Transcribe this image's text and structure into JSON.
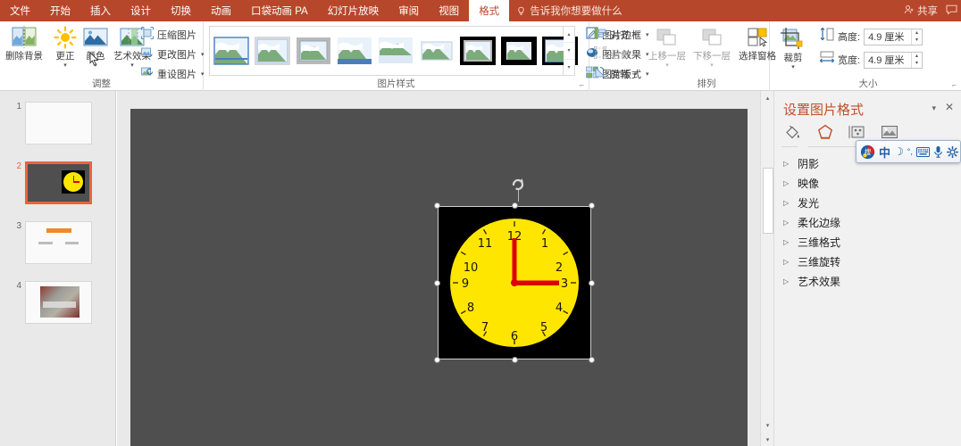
{
  "menubar": {
    "tabs": [
      {
        "label": "文件",
        "active": false
      },
      {
        "label": "开始",
        "active": false
      },
      {
        "label": "插入",
        "active": false
      },
      {
        "label": "设计",
        "active": false
      },
      {
        "label": "切换",
        "active": false
      },
      {
        "label": "动画",
        "active": false
      },
      {
        "label": "口袋动画 PA",
        "active": false
      },
      {
        "label": "幻灯片放映",
        "active": false
      },
      {
        "label": "审阅",
        "active": false
      },
      {
        "label": "视图",
        "active": false
      },
      {
        "label": "格式",
        "active": true
      }
    ],
    "tell_me": "告诉我你想要做什么",
    "share_label": "共享",
    "bulb_icon": "lightbulb-icon",
    "share_icon": "person-add-icon",
    "comment_icon": "comment-icon",
    "accent_color": "#b7472a"
  },
  "ribbon": {
    "groups": [
      {
        "name": "adjust",
        "label": "调整",
        "big_buttons": [
          {
            "label": "删除背景",
            "icon": "remove-background-icon",
            "has_caret": false
          },
          {
            "label": "更正",
            "icon": "corrections-sun-icon",
            "has_caret": true
          },
          {
            "label": "颜色",
            "icon": "color-picture-icon",
            "has_caret": true
          },
          {
            "label": "艺术效果",
            "icon": "artistic-effects-icon",
            "has_caret": true
          }
        ],
        "small_buttons": [
          {
            "label": "压缩图片",
            "icon": "compress-picture-icon",
            "has_caret": false
          },
          {
            "label": "更改图片",
            "icon": "change-picture-icon",
            "has_caret": true
          },
          {
            "label": "重设图片",
            "icon": "reset-picture-icon",
            "has_caret": true
          }
        ]
      },
      {
        "name": "picture-styles",
        "label": "图片样式",
        "gallery_count": 9,
        "small_buttons": [
          {
            "label": "图片边框",
            "icon": "picture-border-icon",
            "has_caret": true
          },
          {
            "label": "图片效果",
            "icon": "picture-effects-icon",
            "has_caret": true
          },
          {
            "label": "图片版式",
            "icon": "picture-layout-icon",
            "has_caret": true
          }
        ]
      },
      {
        "name": "arrange",
        "label": "排列",
        "big_buttons": [
          {
            "label": "上移一层",
            "icon": "bring-forward-icon",
            "has_caret": true,
            "dim": true
          },
          {
            "label": "下移一层",
            "icon": "send-backward-icon",
            "has_caret": true,
            "dim": true
          },
          {
            "label": "选择窗格",
            "icon": "selection-pane-icon",
            "has_caret": false,
            "dim": false
          }
        ],
        "small_buttons": [
          {
            "label": "对齐",
            "icon": "align-icon",
            "has_caret": true,
            "dim": false
          },
          {
            "label": "组合",
            "icon": "group-icon",
            "has_caret": true,
            "dim": true
          },
          {
            "label": "旋转",
            "icon": "rotate-icon",
            "has_caret": true,
            "dim": false
          }
        ]
      },
      {
        "name": "size",
        "label": "大小",
        "big_buttons": [
          {
            "label": "裁剪",
            "icon": "crop-icon",
            "has_caret": true
          }
        ],
        "fields": [
          {
            "label": "高度:",
            "value": "4.9 厘米",
            "icon": "height-icon"
          },
          {
            "label": "宽度:",
            "value": "4.9 厘米",
            "icon": "width-icon"
          }
        ]
      }
    ]
  },
  "slides": [
    {
      "number": "1",
      "selected": false,
      "kind": "blank"
    },
    {
      "number": "2",
      "selected": true,
      "kind": "clock"
    },
    {
      "number": "3",
      "selected": false,
      "kind": "text"
    },
    {
      "number": "4",
      "selected": false,
      "kind": "photo"
    }
  ],
  "canvas": {
    "slide_background": "#4f4f4f",
    "picture": {
      "name": "clock-picture",
      "background": "#000000",
      "face_color": "#ffe600",
      "hand_color": "#dd0000",
      "numbers": [
        "12",
        "1",
        "2",
        "3",
        "4",
        "5",
        "6",
        "7",
        "8",
        "9",
        "10",
        "11"
      ],
      "time_shown": "3:00"
    },
    "rotate_handle_icon": "rotate-handle-icon",
    "handle_count": 8
  },
  "format_pane": {
    "title": "设置图片格式",
    "caret_icon": "chevron-down-icon",
    "close_icon": "close-icon",
    "tabs": [
      {
        "name": "fill-line-tab",
        "icon": "paint-bucket-icon",
        "active": false
      },
      {
        "name": "effects-tab",
        "icon": "pentagon-effects-icon",
        "active": true
      },
      {
        "name": "size-properties-tab",
        "icon": "size-properties-icon",
        "active": false
      },
      {
        "name": "picture-tab",
        "icon": "picture-icon",
        "active": false
      }
    ],
    "sections": [
      {
        "label": "阴影",
        "expanded": false
      },
      {
        "label": "映像",
        "expanded": false
      },
      {
        "label": "发光",
        "expanded": false
      },
      {
        "label": "柔化边缘",
        "expanded": false
      },
      {
        "label": "三维格式",
        "expanded": false
      },
      {
        "label": "三维旋转",
        "expanded": false
      },
      {
        "label": "艺术效果",
        "expanded": false
      }
    ]
  },
  "ime_toolbar": {
    "items": [
      {
        "name": "ime-logo-icon",
        "glyph": "搜"
      },
      {
        "name": "chinese-mode-icon",
        "glyph": "中"
      },
      {
        "name": "moon-icon",
        "glyph": "☽"
      },
      {
        "name": "punctuation-icon",
        "glyph": "°,"
      },
      {
        "name": "soft-keyboard-icon",
        "glyph": "⌨"
      },
      {
        "name": "voice-input-icon",
        "glyph": "🎤"
      },
      {
        "name": "ime-settings-icon",
        "glyph": "⚙"
      }
    ]
  },
  "scrollbar": {
    "up_arrow_icon": "scroll-up-icon",
    "down_arrow_icon": "scroll-down-icon"
  }
}
